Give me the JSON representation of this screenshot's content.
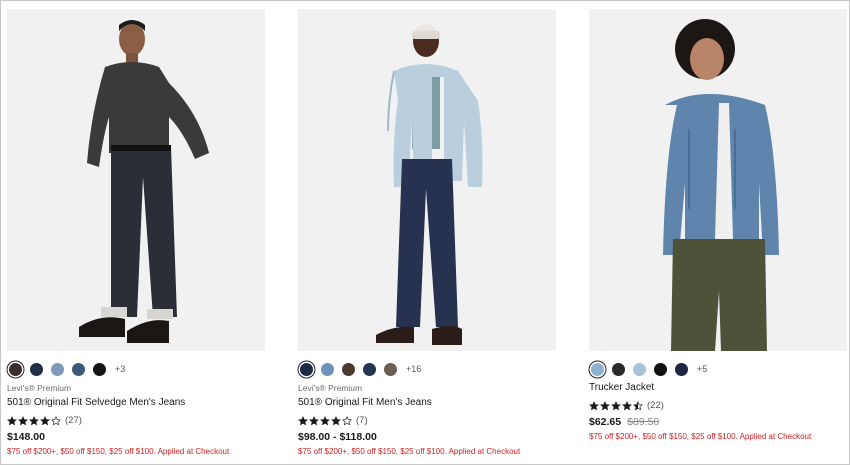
{
  "products": [
    {
      "brand": "Levi's® Premium",
      "name": "501® Original Fit Selvedge Men's Jeans",
      "rating": 4,
      "review_count": "(27)",
      "price": "$148.00",
      "original_price": "",
      "promo": "$75 off $200+, $50 off $150, $25 off $100. Applied at Checkout",
      "swatches": [
        "#3a2f2d",
        "#1f2f48",
        "#7d9bb7",
        "#3e5a7a",
        "#141414"
      ],
      "selected_swatch": 0,
      "more_colors": "+3"
    },
    {
      "brand": "Levi's® Premium",
      "name": "501® Original Fit Men's Jeans",
      "rating": 4,
      "review_count": "(7)",
      "price": "$98.00 - $118.00",
      "original_price": "",
      "promo": "$75 off $200+, $50 off $150, $25 off $100. Applied at Checkout",
      "swatches": [
        "#1c2a45",
        "#6f92bb",
        "#4a3a30",
        "#253552",
        "#6c5f55"
      ],
      "selected_swatch": 0,
      "more_colors": "+16"
    },
    {
      "brand": "",
      "name": "Trucker Jacket",
      "rating": 4.5,
      "review_count": "(22)",
      "price": "$62.65",
      "original_price": "$89.50",
      "promo": "$75 off $200+, $50 off $150, $25 off $100. Applied at Checkout",
      "swatches": [
        "#8fb0cf",
        "#2a2a2a",
        "#a7c3d9",
        "#111111",
        "#1f2740"
      ],
      "selected_swatch": 0,
      "more_colors": "+5"
    }
  ],
  "colors": {
    "promo": "#d31f1f",
    "star": "#1a1a1a",
    "image_bg": "#f1f1f1"
  }
}
